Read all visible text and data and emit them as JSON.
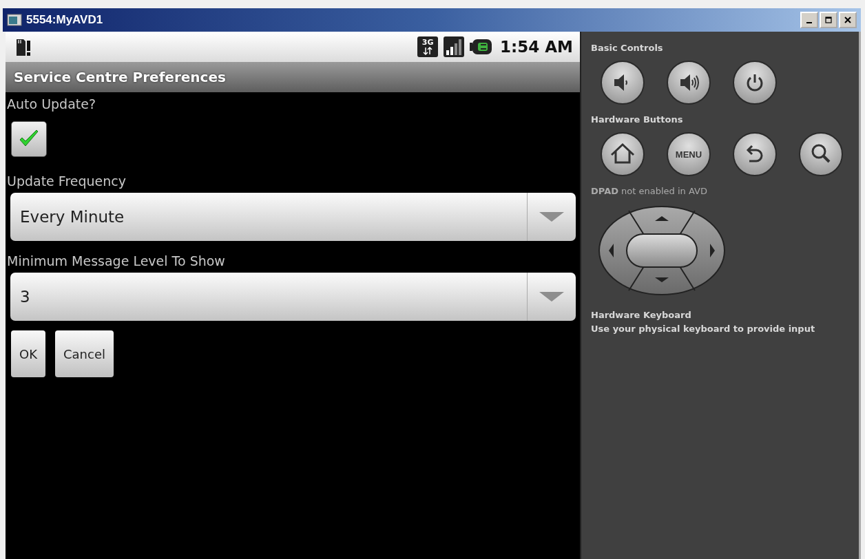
{
  "window": {
    "title": "5554:MyAVD1"
  },
  "status_bar": {
    "network_label": "3G",
    "time": "1:54 AM"
  },
  "app": {
    "title": "Service Centre Preferences",
    "preferences": [
      {
        "kind": "checkbox",
        "label": "Auto Update?",
        "checked": true
      },
      {
        "kind": "spinner",
        "label": "Update Frequency",
        "value": "Every Minute"
      },
      {
        "kind": "spinner",
        "label": "Minimum Message Level To Show",
        "value": "3"
      }
    ],
    "buttons": [
      "OK",
      "Cancel"
    ]
  },
  "controls": {
    "basic_title": "Basic Controls",
    "basic_buttons": [
      {
        "kind": "volume_down"
      },
      {
        "kind": "volume_up"
      },
      {
        "kind": "power"
      }
    ],
    "hardware_title": "Hardware Buttons",
    "hardware_buttons": [
      {
        "kind": "home"
      },
      {
        "kind": "menu",
        "label": "MENU"
      },
      {
        "kind": "back"
      },
      {
        "kind": "search"
      }
    ],
    "dpad_note": "**DPAD** not enabled in AVD",
    "keyboard_title": "Hardware Keyboard",
    "keyboard_note": "Use your physical keyboard to provide input"
  }
}
